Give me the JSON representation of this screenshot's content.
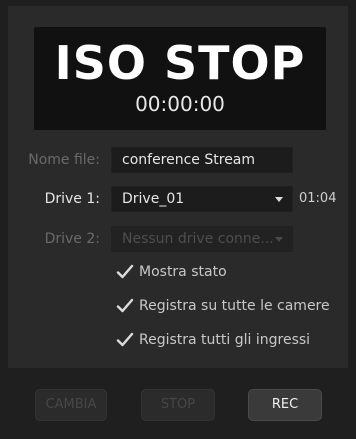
{
  "display": {
    "title": "ISO STOP",
    "time": "00:00:00"
  },
  "form": {
    "filename": {
      "label": "Nome file:",
      "value": "conference Stream"
    },
    "drive1": {
      "label": "Drive 1:",
      "value": "Drive_01",
      "time": "01:04"
    },
    "drive2": {
      "label": "Drive 2:",
      "value": "Nessun drive conne..."
    }
  },
  "options": [
    {
      "label": "Mostra stato",
      "checked": true
    },
    {
      "label": "Registra su tutte le camere",
      "checked": true
    },
    {
      "label": "Registra tutti gli ingressi",
      "checked": true
    }
  ],
  "buttons": {
    "change": "CAMBIA",
    "stop": "STOP",
    "rec": "REC"
  },
  "colors": {
    "panel_bg": "#2a2a2a",
    "display_bg": "#111111",
    "footer_bg": "#1f1f1f",
    "text_primary": "#e6e6e6",
    "text_disabled": "#4e4e4e"
  },
  "icons": {
    "check": "check-icon",
    "dropdown": "chevron-down-icon"
  }
}
